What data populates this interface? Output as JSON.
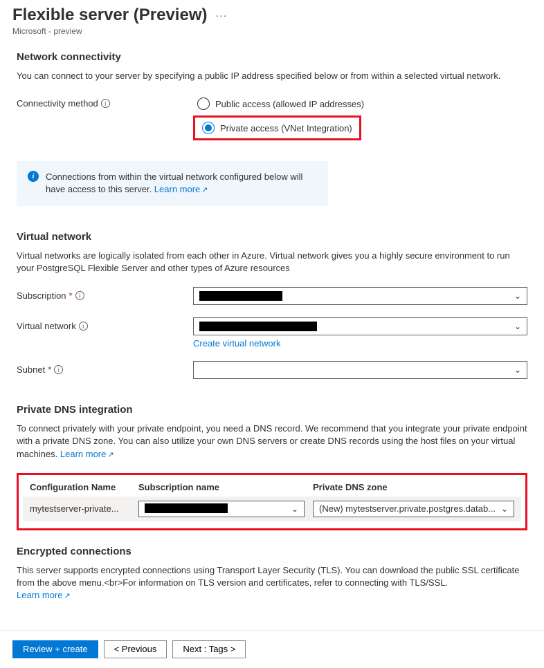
{
  "header": {
    "title": "Flexible server (Preview)",
    "subtitle": "Microsoft - preview"
  },
  "network": {
    "heading": "Network connectivity",
    "description": "You can connect to your server by specifying a public IP address specified below or from within a selected virtual network.",
    "method_label": "Connectivity method",
    "options": {
      "public": "Public access (allowed IP addresses)",
      "private": "Private access (VNet Integration)"
    },
    "info_text": "Connections from within the virtual network configured below will have access to this server. ",
    "info_link": "Learn more"
  },
  "vnet": {
    "heading": "Virtual network",
    "description": "Virtual networks are logically isolated from each other in Azure. Virtual network gives you a highly secure environment to run your PostgreSQL Flexible Server and other types of Azure resources",
    "subscription_label": "Subscription",
    "subscription_value": " ",
    "vnet_label": "Virtual network",
    "vnet_value": " ",
    "create_link": "Create virtual network",
    "subnet_label": "Subnet",
    "subnet_value": ""
  },
  "dns": {
    "heading": "Private DNS integration",
    "description": "To connect privately with your private endpoint, you need a DNS record. We recommend that you integrate your private endpoint with a private DNS zone. You can also utilize your own DNS servers or create DNS records using the host files on your virtual machines. ",
    "learn_more": "Learn more",
    "cols": {
      "config": "Configuration Name",
      "sub": "Subscription name",
      "zone": "Private DNS zone"
    },
    "row": {
      "config": "mytestserver-private...",
      "sub_value": " ",
      "zone_value": "(New) mytestserver.private.postgres.datab..."
    }
  },
  "encrypted": {
    "heading": "Encrypted connections",
    "description": "This server supports encrypted connections using Transport Layer Security (TLS). You can download the public SSL certificate from the above menu.<br>For information on TLS version and certificates, refer to connecting with TLS/SSL. ",
    "learn_more": "Learn more"
  },
  "footer": {
    "review": "Review + create",
    "previous": "< Previous",
    "next": "Next : Tags >"
  }
}
